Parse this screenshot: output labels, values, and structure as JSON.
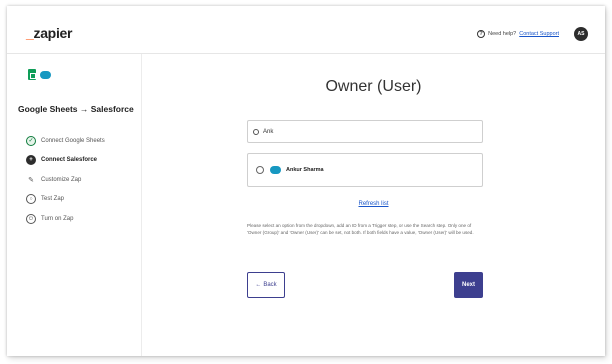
{
  "header": {
    "logo_prefix": "_",
    "logo_text": "zapier",
    "help_text": "Need help?",
    "support_link": "Contact Support",
    "avatar_initials": "AS"
  },
  "sidebar": {
    "zap_title": "Google Sheets → Salesforce",
    "steps": [
      {
        "label": "Connect Google Sheets",
        "state": "done",
        "icon": "check-icon"
      },
      {
        "label": "Connect Salesforce",
        "state": "active",
        "icon": "plus-icon"
      },
      {
        "label": "Customize Zap",
        "state": "todo",
        "icon": "pencil-icon"
      },
      {
        "label": "Test Zap",
        "state": "todo",
        "icon": "test-icon"
      },
      {
        "label": "Turn on Zap",
        "state": "todo",
        "icon": "power-icon"
      }
    ]
  },
  "main": {
    "title": "Owner (User)",
    "search_value": "Ank",
    "options": [
      {
        "label": "Ankur Sharma",
        "icon": "salesforce-icon"
      }
    ],
    "refresh_label": "Refresh list",
    "help_text": "Please select an option from the dropdown, add an ID from a Trigger step, or use the Search step. Only one of 'Owner (Group)' and 'Owner (User)' can be set, not both. If both fields have a value, 'Owner (User)' will be used.",
    "back_label": "Back",
    "back_arrow": "←",
    "next_label": "Next"
  },
  "colors": {
    "brand_orange": "#ff4a00",
    "primary_button": "#3d3f8f",
    "link": "#1a56c9",
    "done_green": "#0f7b3c",
    "salesforce_blue": "#1798c1"
  }
}
